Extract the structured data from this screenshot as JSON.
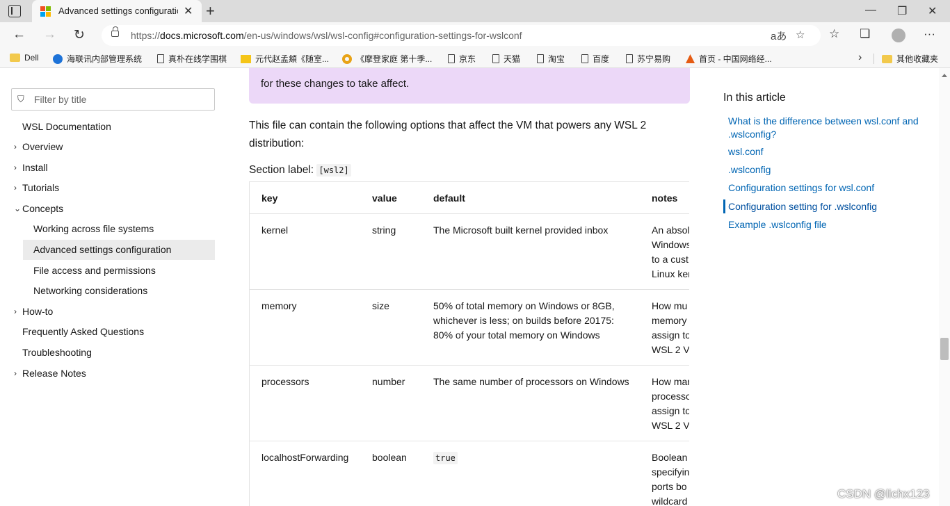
{
  "browser": {
    "tab_title": "Advanced settings configuration",
    "url_prefix": "https://",
    "url_domain": "docs.microsoft.com",
    "url_path": "/en-us/windows/wsl/wsl-config#configuration-settings-for-wslconf",
    "bookmarks": [
      {
        "label": "Dell",
        "icon": "folder-icon"
      },
      {
        "label": "海联讯内部管理系统",
        "icon": "globe-icon"
      },
      {
        "label": "真朴在线学围棋",
        "icon": "page-icon"
      },
      {
        "label": "元代赵孟頫《随室...",
        "icon": "note-icon"
      },
      {
        "label": "《摩登家庭 第十季...",
        "icon": "ring-icon"
      },
      {
        "label": "京东",
        "icon": "page-icon"
      },
      {
        "label": "天猫",
        "icon": "page-icon"
      },
      {
        "label": "淘宝",
        "icon": "page-icon"
      },
      {
        "label": "百度",
        "icon": "page-icon"
      },
      {
        "label": "苏宁易购",
        "icon": "page-icon"
      },
      {
        "label": "首页 - 中国网络经...",
        "icon": "red-icon"
      }
    ],
    "other_bookmarks": "其他收藏夹"
  },
  "sidebar": {
    "filter_placeholder": "Filter by title",
    "items": [
      {
        "label": "WSL Documentation"
      },
      {
        "label": "Overview"
      },
      {
        "label": "Install"
      },
      {
        "label": "Tutorials"
      },
      {
        "label": "Concepts"
      },
      {
        "label": "Working across file systems"
      },
      {
        "label": "Advanced settings configuration"
      },
      {
        "label": "File access and permissions"
      },
      {
        "label": "Networking considerations"
      },
      {
        "label": "How-to"
      },
      {
        "label": "Frequently Asked Questions"
      },
      {
        "label": "Troubleshooting"
      },
      {
        "label": "Release Notes"
      }
    ]
  },
  "main": {
    "note_text": "for these changes to take affect.",
    "paragraph": "This file can contain the following options that affect the VM that powers any WSL 2 distribution:",
    "section_label": "Section label:",
    "section_code": "[wsl2]",
    "table": {
      "headers": [
        "key",
        "value",
        "default",
        "notes"
      ],
      "rows": [
        {
          "key": "kernel",
          "value": "string",
          "default": "The Microsoft built kernel provided inbox",
          "notes": [
            "An absol",
            "Windows",
            "to a cust",
            "Linux ker"
          ]
        },
        {
          "key": "memory",
          "value": "size",
          "default": "50% of total memory on Windows or 8GB, whichever is less; on builds before 20175: 80% of your total memory on Windows",
          "notes": [
            "How mu",
            "memory",
            "assign to",
            "WSL 2 VI"
          ]
        },
        {
          "key": "processors",
          "value": "number",
          "default": "The same number of processors on Windows",
          "notes": [
            "How mar",
            "processo",
            "assign to",
            "WSL 2 VI"
          ]
        },
        {
          "key": "localhostForwarding",
          "value": "boolean",
          "default": "true",
          "notes": [
            "Boolean",
            "specifyin",
            "ports bo",
            "wildcard"
          ]
        }
      ]
    }
  },
  "article_toc": {
    "heading": "In this article",
    "links": [
      "What is the difference between wsl.conf and .wslconfig?",
      "wsl.conf",
      ".wslconfig",
      "Configuration settings for wsl.conf",
      "Configuration setting for .wslconfig",
      "Example .wslconfig file"
    ]
  },
  "watermark": "CSDN @lichx123",
  "colors": {
    "accent": "#0065b3",
    "note_bg": "#ecd8f8"
  }
}
